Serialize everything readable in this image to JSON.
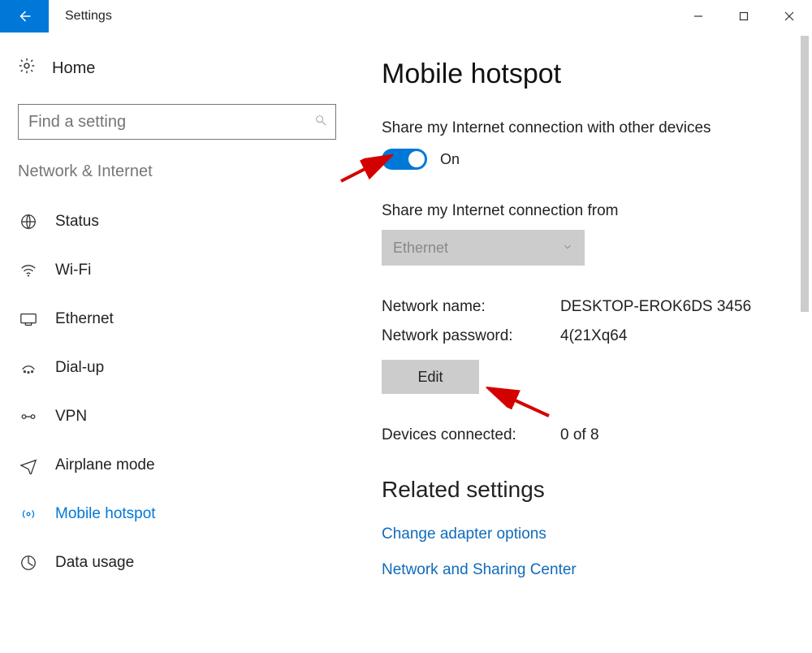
{
  "window": {
    "title": "Settings"
  },
  "sidebar": {
    "home_label": "Home",
    "search_placeholder": "Find a setting",
    "category": "Network & Internet",
    "items": [
      {
        "icon": "globe-icon",
        "label": "Status"
      },
      {
        "icon": "wifi-icon",
        "label": "Wi-Fi"
      },
      {
        "icon": "ethernet-icon",
        "label": "Ethernet"
      },
      {
        "icon": "dialup-icon",
        "label": "Dial-up"
      },
      {
        "icon": "vpn-icon",
        "label": "VPN"
      },
      {
        "icon": "airplane-icon",
        "label": "Airplane mode"
      },
      {
        "icon": "hotspot-icon",
        "label": "Mobile hotspot",
        "active": true
      },
      {
        "icon": "datausage-icon",
        "label": "Data usage"
      }
    ]
  },
  "main": {
    "title": "Mobile hotspot",
    "share_label": "Share my Internet connection with other devices",
    "toggle_state": "On",
    "share_from_label": "Share my Internet connection from",
    "share_from_value": "Ethernet",
    "network_name_key": "Network name:",
    "network_name_value": "DESKTOP-EROK6DS 3456",
    "network_password_key": "Network password:",
    "network_password_value": "4(21Xq64",
    "edit_label": "Edit",
    "devices_key": "Devices connected:",
    "devices_value": "0 of 8",
    "related_title": "Related settings",
    "related_links": [
      "Change adapter options",
      "Network and Sharing Center"
    ]
  }
}
